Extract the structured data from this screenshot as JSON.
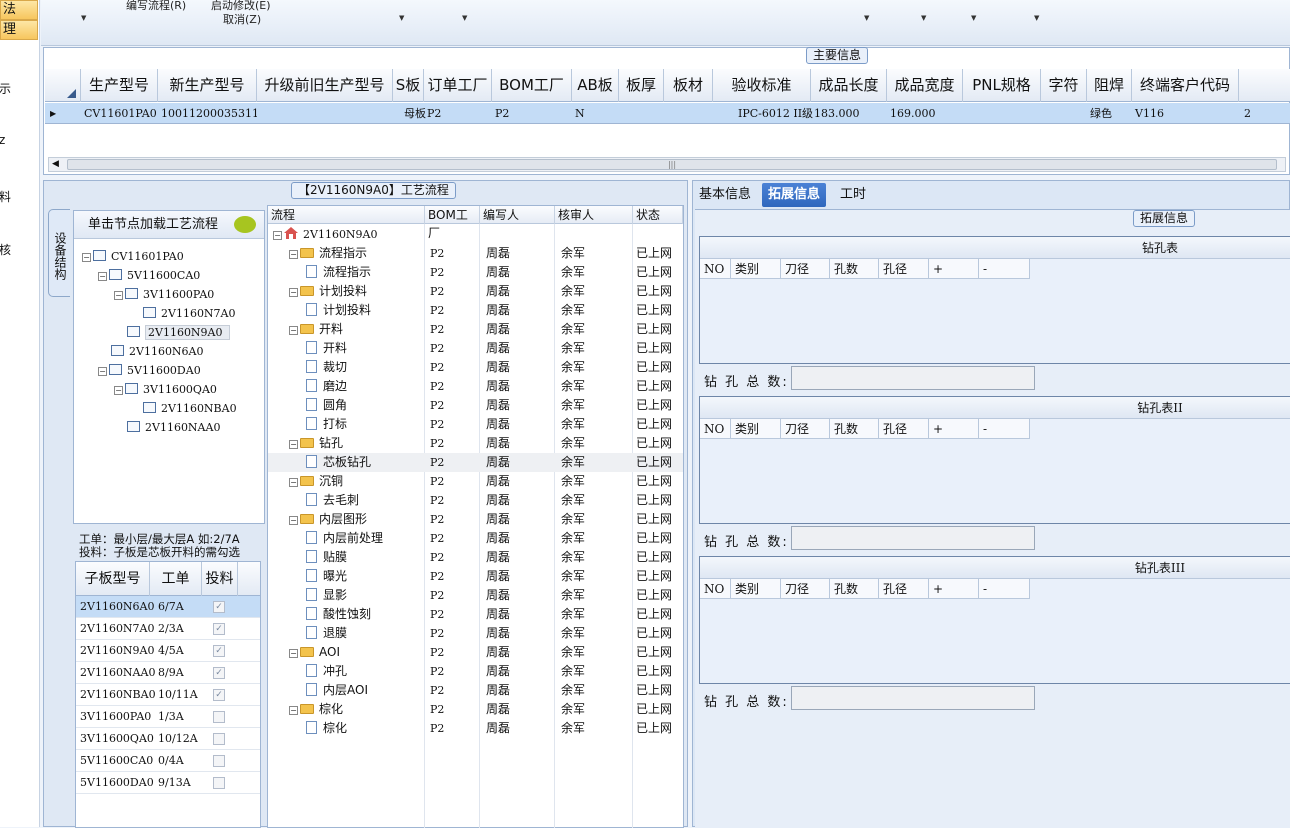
{
  "sidebar": {
    "items": [
      "法",
      "理",
      "示",
      "z",
      "料",
      "核"
    ]
  },
  "toolbar": {
    "buttons": [
      "编写流程(R)",
      "启动修改(E)",
      "取消(Z)"
    ]
  },
  "main_info": {
    "title": "主要信息",
    "columns": [
      "生产型号",
      "新生产型号",
      "升级前旧生产型号",
      "S板",
      "订单工厂",
      "BOM工厂",
      "AB板",
      "板厚",
      "板材",
      "验收标准",
      "成品长度",
      "成品宽度",
      "PNL规格",
      "字符",
      "阻焊",
      "终端客户代码"
    ],
    "row": [
      "CV11601PA0",
      "10011200035311",
      "",
      "母板",
      "P2",
      "P2",
      "N",
      "",
      "",
      "IPC-6012 II级",
      "183.000",
      "169.000",
      "",
      "",
      "绿色",
      "V116"
    ],
    "row_extra": "2"
  },
  "process": {
    "vertical_tab": "设备结构",
    "tree_header": "单击节点加载工艺流程",
    "tree": [
      "CV11601PA0",
      "5V11600CA0",
      "3V11600PA0",
      "2V1160N7A0",
      "2V1160N9A0",
      "2V1160N6A0",
      "5V11600DA0",
      "3V11600QA0",
      "2V1160NBA0",
      "2V1160NAA0"
    ],
    "note_line1": "工单：最小层/最大层A 如:2/7A",
    "note_line2": "投料：子板是芯板开料的需勾选",
    "sub_columns": [
      "子板型号",
      "工单",
      "投料"
    ],
    "sub_rows": [
      {
        "model": "2V1160N6A0",
        "order": "6/7A",
        "checked": true
      },
      {
        "model": "2V1160N7A0",
        "order": "2/3A",
        "checked": true
      },
      {
        "model": "2V1160N9A0",
        "order": "4/5A",
        "checked": true
      },
      {
        "model": "2V1160NAA0",
        "order": "8/9A",
        "checked": true
      },
      {
        "model": "2V1160NBA0",
        "order": "10/11A",
        "checked": true
      },
      {
        "model": "3V11600PA0",
        "order": "1/3A",
        "checked": false
      },
      {
        "model": "3V11600QA0",
        "order": "10/12A",
        "checked": false
      },
      {
        "model": "5V11600CA0",
        "order": "0/4A",
        "checked": false
      },
      {
        "model": "5V11600DA0",
        "order": "9/13A",
        "checked": false
      }
    ],
    "flow_title": "【2V1160N9A0】工艺流程",
    "flow_columns": [
      "流程",
      "BOM工厂",
      "编写人",
      "核审人",
      "状态"
    ],
    "flow_root": "2V1160N9A0",
    "flow_rows": [
      {
        "name": "流程指示",
        "type": "folder"
      },
      {
        "name": "流程指示",
        "type": "doc"
      },
      {
        "name": "计划投料",
        "type": "folder"
      },
      {
        "name": "计划投料",
        "type": "doc"
      },
      {
        "name": "开料",
        "type": "folder"
      },
      {
        "name": "开料",
        "type": "doc"
      },
      {
        "name": "裁切",
        "type": "doc"
      },
      {
        "name": "磨边",
        "type": "doc"
      },
      {
        "name": "圆角",
        "type": "doc"
      },
      {
        "name": "打标",
        "type": "doc"
      },
      {
        "name": "钻孔",
        "type": "folder"
      },
      {
        "name": "芯板钻孔",
        "type": "doc"
      },
      {
        "name": "沉铜",
        "type": "folder"
      },
      {
        "name": "去毛刺",
        "type": "doc"
      },
      {
        "name": "内层图形",
        "type": "folder"
      },
      {
        "name": "内层前处理",
        "type": "doc"
      },
      {
        "name": "贴膜",
        "type": "doc"
      },
      {
        "name": "曝光",
        "type": "doc"
      },
      {
        "name": "显影",
        "type": "doc"
      },
      {
        "name": "酸性蚀刻",
        "type": "doc"
      },
      {
        "name": "退膜",
        "type": "doc"
      },
      {
        "name": "AOI",
        "type": "folder"
      },
      {
        "name": "冲孔",
        "type": "doc"
      },
      {
        "name": "内层AOI",
        "type": "doc"
      },
      {
        "name": "棕化",
        "type": "folder"
      },
      {
        "name": "棕化",
        "type": "doc"
      }
    ],
    "flow_values": {
      "bom": "P2",
      "author": "周磊",
      "reviewer": "余军",
      "status": "已上网"
    }
  },
  "ext": {
    "tabs": [
      "基本信息",
      "拓展信息",
      "工时"
    ],
    "title": "拓展信息",
    "tables": [
      "钻孔表",
      "钻孔表II",
      "钻孔表III"
    ],
    "columns": [
      "NO",
      "类别",
      "刀径",
      "孔数",
      "孔径",
      "+",
      "-"
    ],
    "total_label": "钻 孔 总 数:"
  }
}
